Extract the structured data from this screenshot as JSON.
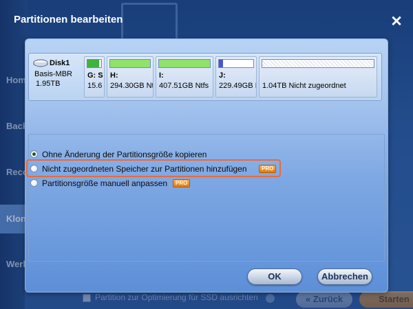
{
  "background": {
    "sidebar_items": [
      "Home",
      "Backup",
      "Recovery",
      "Klonen",
      "Werkzeuge"
    ],
    "active_sidebar_index": 3,
    "footer": {
      "checkbox_label": "Partition zur Optimierung für SSD ausrichten",
      "back_label": "« Zurück",
      "start_label": "Starten"
    }
  },
  "dialog": {
    "title": "Partitionen bearbeiten",
    "close_glyph": "✕",
    "disk": {
      "name": "Disk1",
      "type": "Basis-MBR",
      "size": "1.95TB",
      "partitions": [
        {
          "label": "G: S",
          "info": "15.6",
          "used_fraction": 0.85,
          "color": "#3db43d"
        },
        {
          "label": "H:",
          "info": "294.30GB Nt",
          "used_fraction": 1.0,
          "color": "#8fe36a"
        },
        {
          "label": "I:",
          "info": "407.51GB Ntfs",
          "used_fraction": 1.0,
          "color": "#8fe36a"
        },
        {
          "label": "J:",
          "info": "229.49GB I",
          "used_fraction": 0.12,
          "color": "#4b55c8"
        },
        {
          "label": "",
          "info": "1.04TB Nicht zugeordnet",
          "used_fraction": 0.0,
          "color": "#ffffff"
        }
      ]
    },
    "options": [
      {
        "label": "Ohne Änderung der Partitionsgröße kopieren",
        "selected": true,
        "pro": false
      },
      {
        "label": "Nicht zugeordneten Speicher zur Partitionen hinzufügen",
        "selected": false,
        "pro": true,
        "highlighted": true
      },
      {
        "label": "Partitionsgröße manuell anpassen",
        "selected": false,
        "pro": true
      }
    ],
    "pro_badge": "PRO",
    "ok_label": "OK",
    "cancel_label": "Abbrechen",
    "highlight_color": "#e86a3a"
  }
}
